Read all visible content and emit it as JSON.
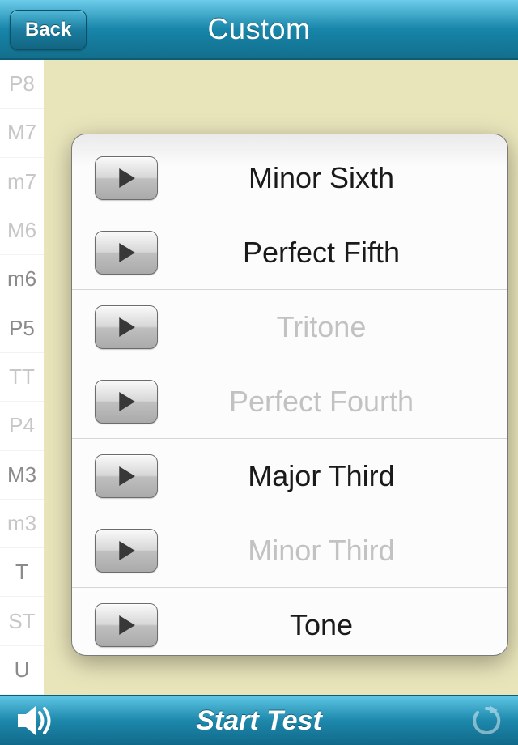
{
  "header": {
    "title": "Custom",
    "back_label": "Back"
  },
  "sidebar": {
    "items": [
      {
        "label": "P8",
        "selected": false
      },
      {
        "label": "M7",
        "selected": false
      },
      {
        "label": "m7",
        "selected": false
      },
      {
        "label": "M6",
        "selected": false
      },
      {
        "label": "m6",
        "selected": true
      },
      {
        "label": "P5",
        "selected": true
      },
      {
        "label": "TT",
        "selected": false
      },
      {
        "label": "P4",
        "selected": false
      },
      {
        "label": "M3",
        "selected": true
      },
      {
        "label": "m3",
        "selected": false
      },
      {
        "label": "T",
        "selected": true
      },
      {
        "label": "ST",
        "selected": false
      },
      {
        "label": "U",
        "selected": true
      }
    ]
  },
  "panel": {
    "rows": [
      {
        "label": "Minor Sixth",
        "enabled": true
      },
      {
        "label": "Perfect Fifth",
        "enabled": true
      },
      {
        "label": "Tritone",
        "enabled": false
      },
      {
        "label": "Perfect Fourth",
        "enabled": false
      },
      {
        "label": "Major Third",
        "enabled": true
      },
      {
        "label": "Minor Third",
        "enabled": false
      },
      {
        "label": "Tone",
        "enabled": true
      }
    ]
  },
  "footer": {
    "start_label": "Start Test"
  }
}
